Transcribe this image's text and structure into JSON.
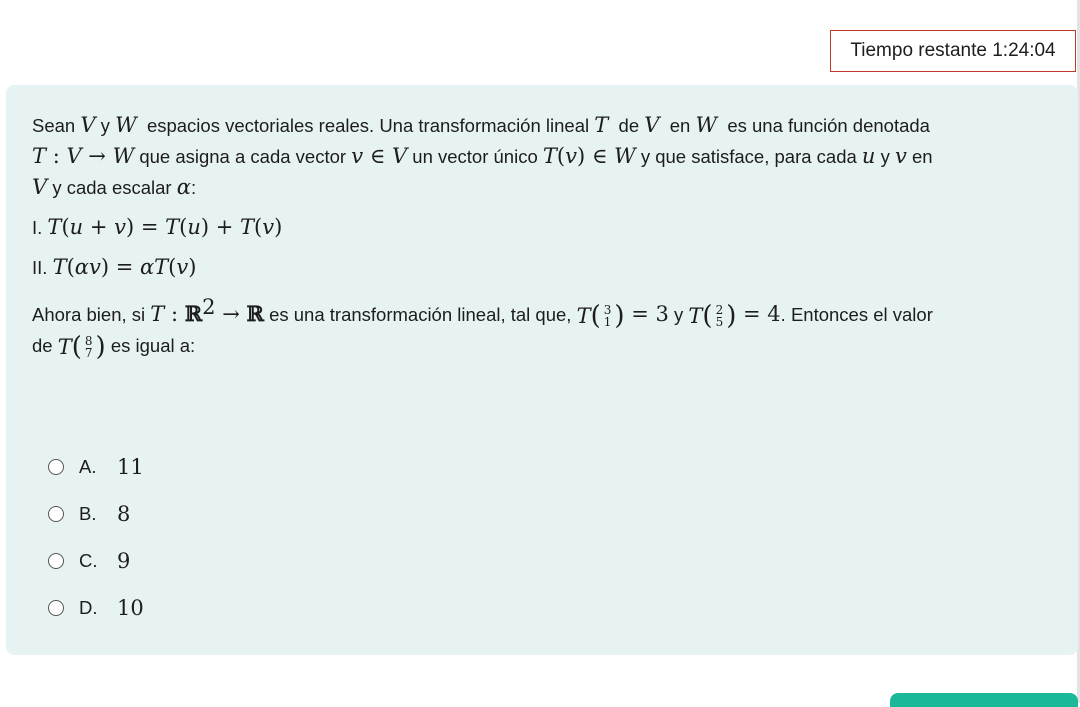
{
  "timer": {
    "label": "Tiempo restante",
    "value": "1:24:04"
  },
  "question": {
    "p1": {
      "t1": "Sean",
      "t2": "y",
      "t3": "espacios vectoriales reales. Una transformación lineal",
      "t4": "de",
      "t5": "en",
      "t6": "es una función denotada"
    },
    "p2": {
      "t1": "que asigna a cada vector",
      "t2": "un vector único",
      "t3": "y que satisface, para cada",
      "t4": "y",
      "t5": "en"
    },
    "p3": {
      "t1": "y cada escalar",
      "t2": ":"
    },
    "items": [
      {
        "num": "I."
      },
      {
        "num": "II."
      }
    ],
    "p4": {
      "t1": "Ahora bien, si",
      "t2": "es una transformación lineal, tal que,",
      "t3": "y",
      "t4": ". Entonces el valor"
    },
    "p5": {
      "t1": "de",
      "t2": "es igual a:"
    }
  },
  "options": [
    {
      "letter": "A.",
      "value": "11"
    },
    {
      "letter": "B.",
      "value": "8"
    },
    {
      "letter": "C.",
      "value": "9"
    },
    {
      "letter": "D.",
      "value": "10"
    }
  ]
}
